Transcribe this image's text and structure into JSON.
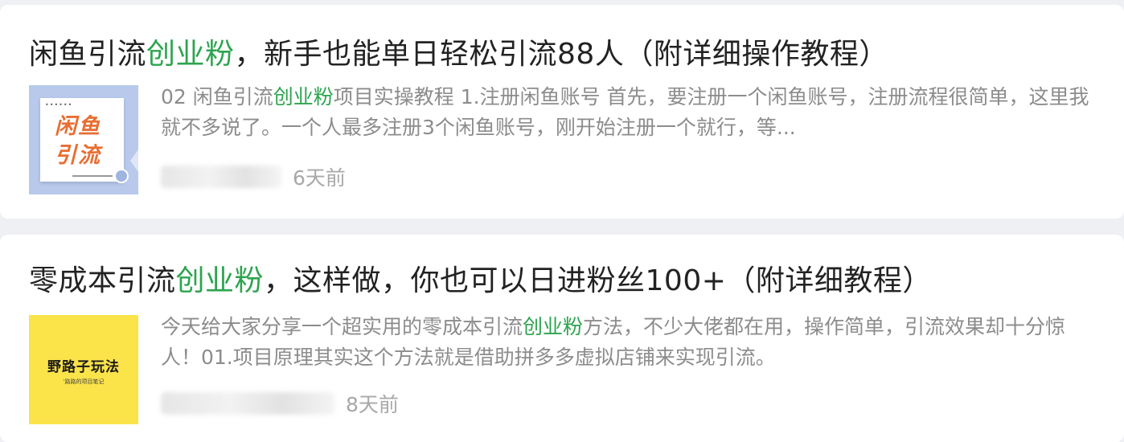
{
  "articles": [
    {
      "title": {
        "pre": "闲鱼引流",
        "keyword": "创业粉",
        "post": "，新手也能单日轻松引流88人（附详细操作教程）"
      },
      "excerpt": {
        "pre": "02 闲鱼引流",
        "keyword": "创业粉",
        "post": "项目实操教程 1.注册闲鱼账号 首先，要注册一个闲鱼账号，注册流程很简单，这里我就不多说了。一个人最多注册3个闲鱼账号，刚开始注册一个就行，等..."
      },
      "thumbnail": {
        "icon": "xianyu-traffic-thumbnail",
        "text": "闲鱼引流",
        "bg_color": "#b8c9ec",
        "text_color": "#e86e33"
      },
      "time": "6天前"
    },
    {
      "title": {
        "pre": "零成本引流",
        "keyword": "创业粉",
        "post": "，这样做，你也可以日进粉丝100+（附详细教程）"
      },
      "excerpt": {
        "pre": "今天给大家分享一个超实用的零成本引流",
        "keyword": "创业粉",
        "post": "方法，不少大佬都在用，操作简单，引流效果却十分惊人！01.项目原理其实这个方法就是借助拼多多虚拟店铺来实现引流。"
      },
      "thumbnail": {
        "icon": "wild-tricks-thumbnail",
        "text": "野路子玩法",
        "subtext": "'路路的项目笔记",
        "bg_color": "#fbe34a"
      },
      "time": "8天前"
    }
  ],
  "colors": {
    "keyword": "#2ca44e",
    "title": "#222222",
    "excerpt": "#8c8c8c",
    "time": "#a8a8a8",
    "page_bg": "#eef0f3"
  }
}
